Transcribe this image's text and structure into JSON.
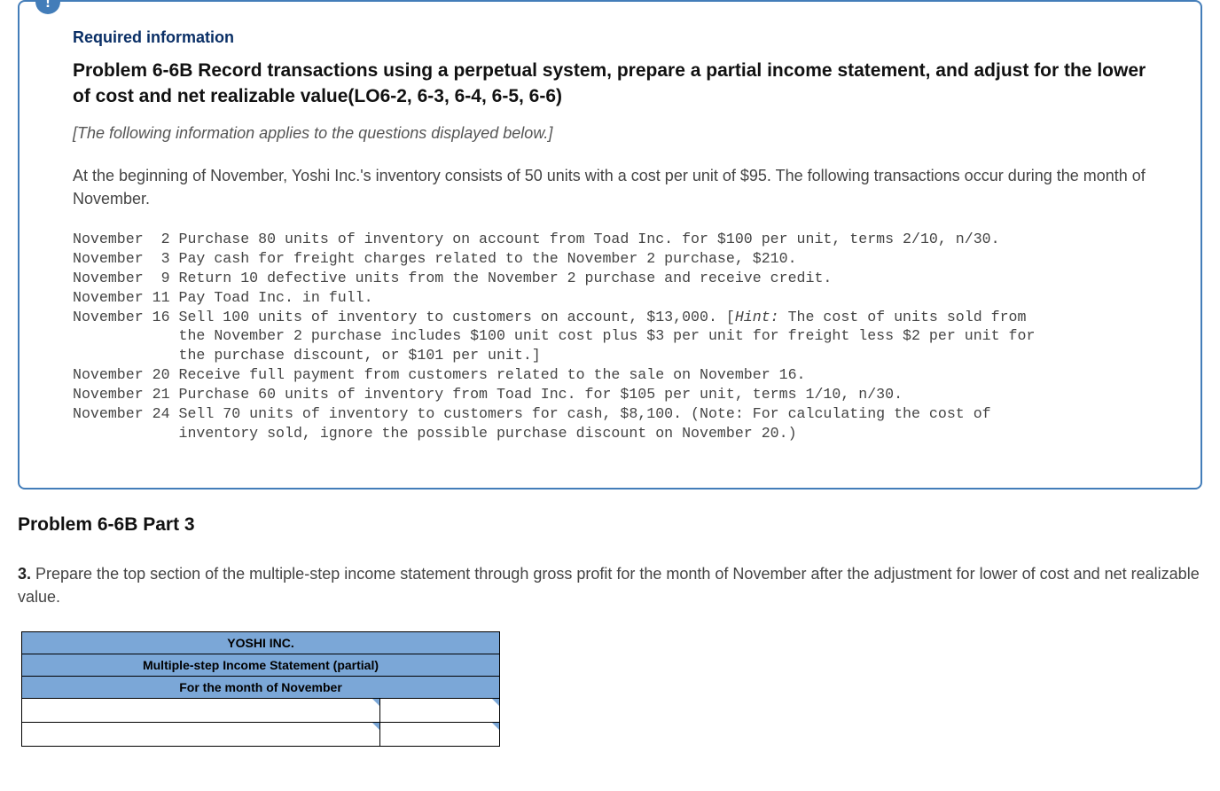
{
  "badge": {
    "symbol": "!"
  },
  "info": {
    "heading": "Required information",
    "title": "Problem 6-6B Record transactions using a perpetual system, prepare a partial income statement, and adjust for the lower of cost and net realizable value(LO6-2, 6-3, 6-4, 6-5, 6-6)",
    "instruction": "[The following information applies to the questions displayed below.]",
    "intro": "At the beginning of November, Yoshi Inc.'s inventory consists of 50 units with a cost per unit of $95. The following transactions occur during the month of November."
  },
  "transactions": {
    "line1": "November  2 Purchase 80 units of inventory on account from Toad Inc. for $100 per unit, terms 2/10, n/30.",
    "line2": "November  3 Pay cash for freight charges related to the November 2 purchase, $210.",
    "line3": "November  9 Return 10 defective units from the November 2 purchase and receive credit.",
    "line4": "November 11 Pay Toad Inc. in full.",
    "line5a": "November 16 Sell 100 units of inventory to customers on account, $13,000. [",
    "line5hint": "Hint:",
    "line5b": " The cost of units sold from",
    "line5c": "            the November 2 purchase includes $100 unit cost plus $3 per unit for freight less $2 per unit for",
    "line5d": "            the purchase discount, or $101 per unit.]",
    "line6": "November 20 Receive full payment from customers related to the sale on November 16.",
    "line7": "November 21 Purchase 60 units of inventory from Toad Inc. for $105 per unit, terms 1/10, n/30.",
    "line8": "November 24 Sell 70 units of inventory to customers for cash, $8,100. (Note: For calculating the cost of",
    "line8b": "            inventory sold, ignore the possible purchase discount on November 20.)"
  },
  "part": {
    "title": "Problem 6-6B Part 3",
    "question_num": "3.",
    "question_text": " Prepare the top section of the multiple-step income statement through gross profit for the month of November after the adjustment for lower of cost and net realizable value."
  },
  "table": {
    "header1": "YOSHI INC.",
    "header2": "Multiple-step Income Statement (partial)",
    "header3": "For the month of November",
    "rows": [
      {
        "label": "",
        "amount": ""
      },
      {
        "label": "",
        "amount": ""
      }
    ]
  }
}
